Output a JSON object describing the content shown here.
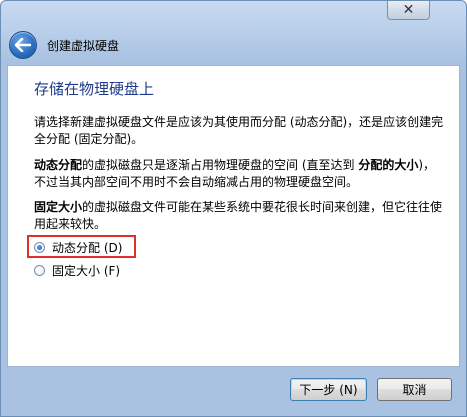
{
  "window": {
    "close_glyph": "✕"
  },
  "header": {
    "title": "创建虚拟硬盘"
  },
  "page": {
    "title": "存储在物理硬盘上",
    "intro": "请选择新建虚拟硬盘文件是应该为其使用而分配 (动态分配)，还是应该创建完全分配 (固定分配)。",
    "dynamic_bold": "动态分配",
    "dynamic_text_1": "的虚拟磁盘只是逐渐占用物理硬盘的空间 (直至达到 ",
    "dynamic_bold_2": "分配的大小",
    "dynamic_text_2": ")，不过当其内部空间不用时不会自动缩减占用的物理硬盘空间。",
    "fixed_bold": "固定大小",
    "fixed_text": "的虚拟磁盘文件可能在某些系统中要花很长时间来创建，但它往往使用起来较快。"
  },
  "options": {
    "dynamic_label": "动态分配 (D)",
    "fixed_label": "固定大小 (F)",
    "selected": "dynamic"
  },
  "buttons": {
    "next_label": "下一步 (N)",
    "cancel_label": "取消"
  },
  "colors": {
    "title_blue": "#1f3c8c",
    "highlight_red": "#e02d2d"
  }
}
